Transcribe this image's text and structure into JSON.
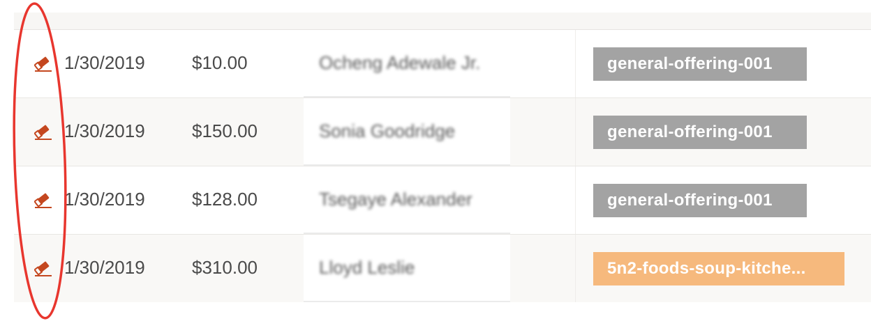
{
  "colors": {
    "accent_bar": "#f3c96c",
    "edit_icon": "#c4471f",
    "tag_gray": "#a3a3a3",
    "tag_orange": "#f6b97d",
    "annotation_ellipse": "#e8362e"
  },
  "rows": [
    {
      "edit_icon": "edit-icon",
      "date": "1/30/2019",
      "amount": "$10.00",
      "donor": "Ocheng Adewale Jr.",
      "tag": "general-offering-001",
      "tag_color": "gray"
    },
    {
      "edit_icon": "edit-icon",
      "date": "1/30/2019",
      "amount": "$150.00",
      "donor": "Sonia Goodridge",
      "tag": "general-offering-001",
      "tag_color": "gray"
    },
    {
      "edit_icon": "edit-icon",
      "date": "1/30/2019",
      "amount": "$128.00",
      "donor": "Tsegaye Alexander",
      "tag": "general-offering-001",
      "tag_color": "gray"
    },
    {
      "edit_icon": "edit-icon",
      "date": "1/30/2019",
      "amount": "$310.00",
      "donor": "Lloyd Leslie",
      "tag": "5n2-foods-soup-kitche...",
      "tag_color": "orange"
    }
  ]
}
